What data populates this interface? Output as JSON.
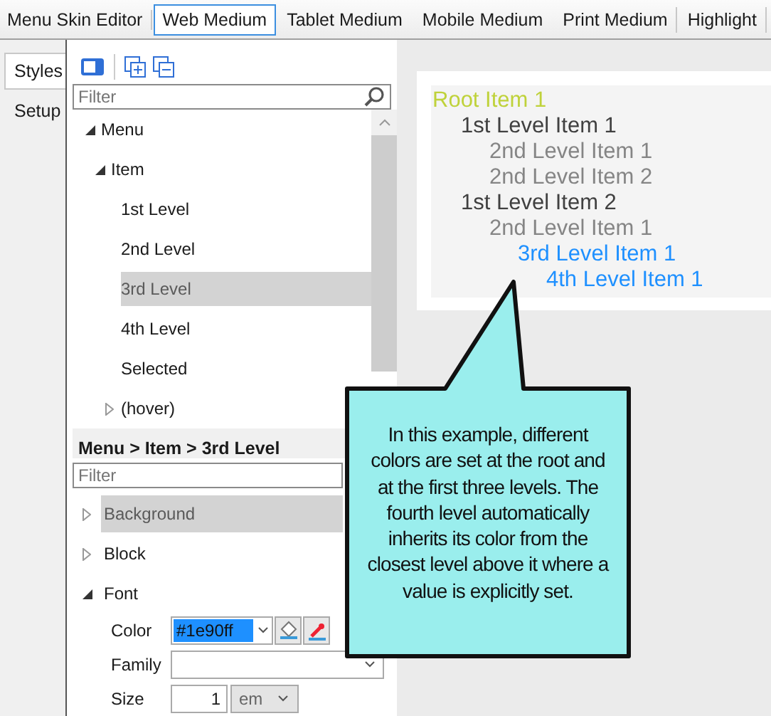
{
  "toolbar": {
    "title": "Menu Skin Editor",
    "tabs": [
      {
        "label": "Web Medium",
        "selected": true
      },
      {
        "label": "Tablet Medium",
        "selected": false
      },
      {
        "label": "Mobile Medium",
        "selected": false
      },
      {
        "label": "Print Medium",
        "selected": false
      },
      {
        "label": "Highlight",
        "selected": false
      }
    ]
  },
  "side_tabs": [
    {
      "label": "Styles",
      "selected": true
    },
    {
      "label": "Setup",
      "selected": false
    }
  ],
  "styles_panel": {
    "filter": {
      "placeholder": "Filter"
    },
    "tree": [
      {
        "label": "Menu",
        "expanded": true,
        "selected": false,
        "children": [
          {
            "label": "Item",
            "expanded": true,
            "selected": false,
            "children": [
              {
                "label": "1st Level",
                "selected": false
              },
              {
                "label": "2nd Level",
                "selected": false
              },
              {
                "label": "3rd Level",
                "selected": true
              },
              {
                "label": "4th Level",
                "selected": false
              },
              {
                "label": "Selected",
                "selected": false
              },
              {
                "label": "(hover)",
                "expanded": false,
                "selected": false
              }
            ]
          }
        ]
      }
    ],
    "breadcrumb": "Menu > Item > 3rd Level",
    "property_filter": {
      "placeholder": "Filter"
    },
    "properties": [
      {
        "label": "Background",
        "expanded": false,
        "selected": true
      },
      {
        "label": "Block",
        "expanded": false,
        "selected": false
      },
      {
        "label": "Font",
        "expanded": true,
        "selected": false,
        "fields": [
          {
            "kind": "color",
            "label": "Color",
            "value": "#1e90ff"
          },
          {
            "kind": "dropdown",
            "label": "Family"
          },
          {
            "kind": "size",
            "label": "Size",
            "value": "1",
            "unit": "em"
          }
        ]
      }
    ]
  },
  "preview": {
    "items": [
      {
        "label": "Root Item 1",
        "color": "#bfd23a",
        "children": [
          {
            "label": "1st Level Item 1",
            "color": "#404040",
            "children": [
              {
                "label": "2nd Level Item 1",
                "color": "#858585"
              },
              {
                "label": "2nd Level Item 2",
                "color": "#858585"
              }
            ]
          },
          {
            "label": "1st Level Item 2",
            "color": "#404040",
            "children": [
              {
                "label": "2nd Level Item 1",
                "color": "#858585",
                "children": [
                  {
                    "label": "3rd Level Item 1",
                    "color": "#1e90ff",
                    "children": [
                      {
                        "label": "4th Level Item 1",
                        "color": "#1e90ff"
                      }
                    ]
                  }
                ]
              }
            ]
          }
        ]
      }
    ]
  },
  "callout": {
    "text": "In this example, different colors are set at the root and at the first three levels. The fourth level automatically inherits its color from the closest level above it where a value is explicitly set."
  }
}
